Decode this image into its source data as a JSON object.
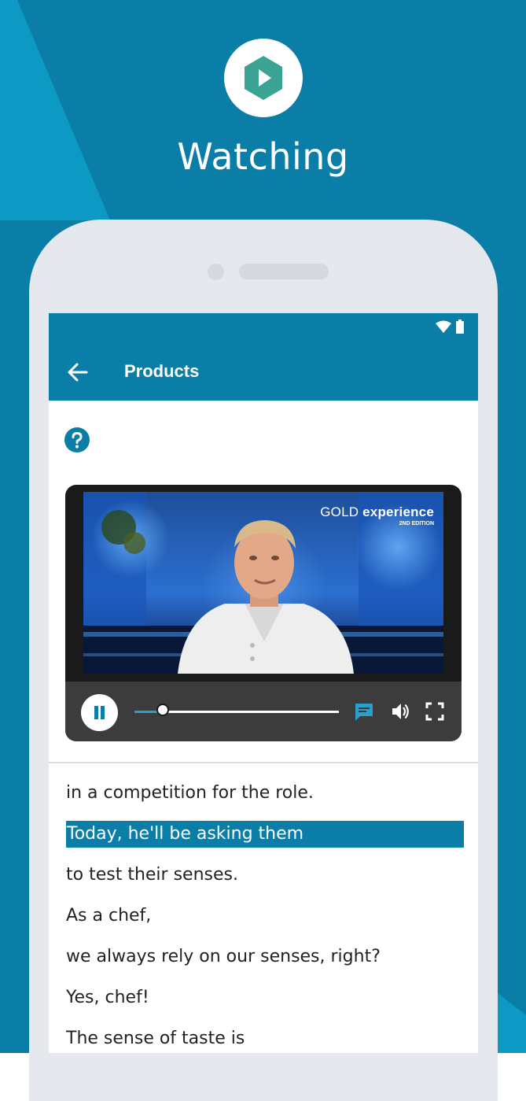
{
  "promo": {
    "icon": "play-hexagon-icon",
    "title": "Watching"
  },
  "status_bar": {
    "icons": [
      "wifi-icon",
      "battery-icon"
    ]
  },
  "app_bar": {
    "back_icon": "arrow-left-icon",
    "title": "Products"
  },
  "help": {
    "icon": "help-circle-icon"
  },
  "video": {
    "brand_gold": "GOLD",
    "brand_experience": "experience",
    "brand_edition": "2ND EDITION",
    "state": "playing",
    "progress": 0.14,
    "controls": [
      "pause-icon",
      "captions-icon",
      "volume-icon",
      "fullscreen-icon"
    ]
  },
  "transcript": {
    "active_index": 1,
    "lines": [
      "in a competition for the role.",
      "Today, he'll be asking them",
      "to test their senses.",
      "As a chef,",
      "we always rely on our senses, right?",
      "Yes, chef!",
      "The sense of taste is"
    ]
  },
  "colors": {
    "background": "#0a7ea6",
    "background_light": "#0c9ac4",
    "app_bar": "#0a7ea6",
    "accent": "#2aa0c8",
    "hexagon": "#3aa394",
    "phone_body": "#e5e9ed"
  }
}
